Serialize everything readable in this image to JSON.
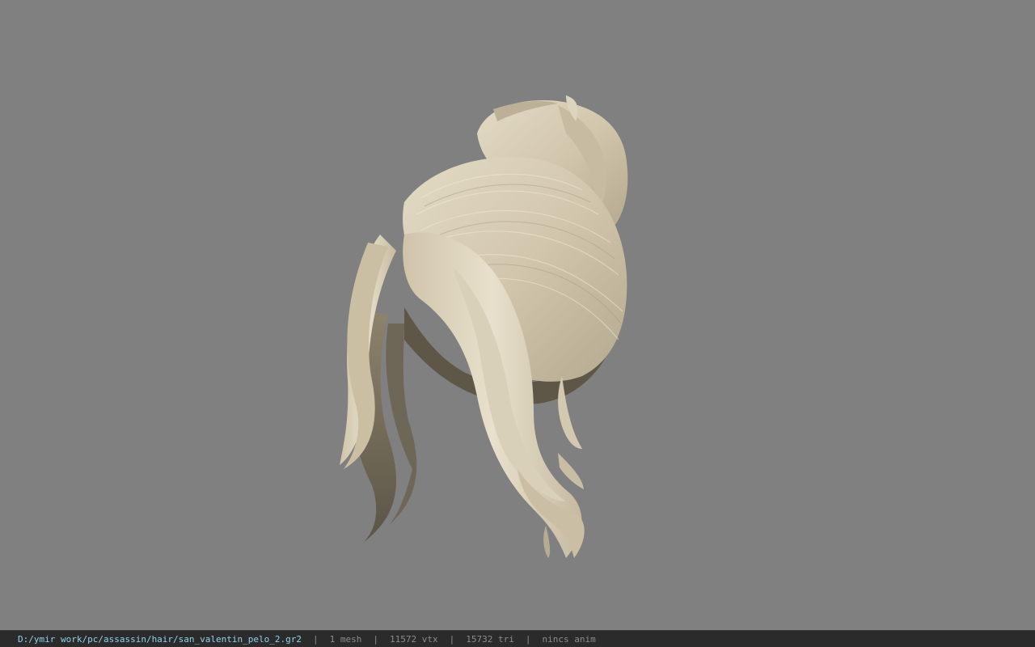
{
  "viewport": {
    "background_color": "#808080",
    "model": "hair-mesh"
  },
  "statusbar": {
    "file_path": "D:/ymir work/pc/assassin/hair/san_valentin_pelo_2.gr2",
    "separator": "|",
    "mesh_count": "1 mesh",
    "vertex_count": "11572 vtx",
    "triangle_count": "15732 tri",
    "anim_status": "nincs anim",
    "path_color": "#8fd3e8",
    "text_color": "#8c8c8c"
  }
}
